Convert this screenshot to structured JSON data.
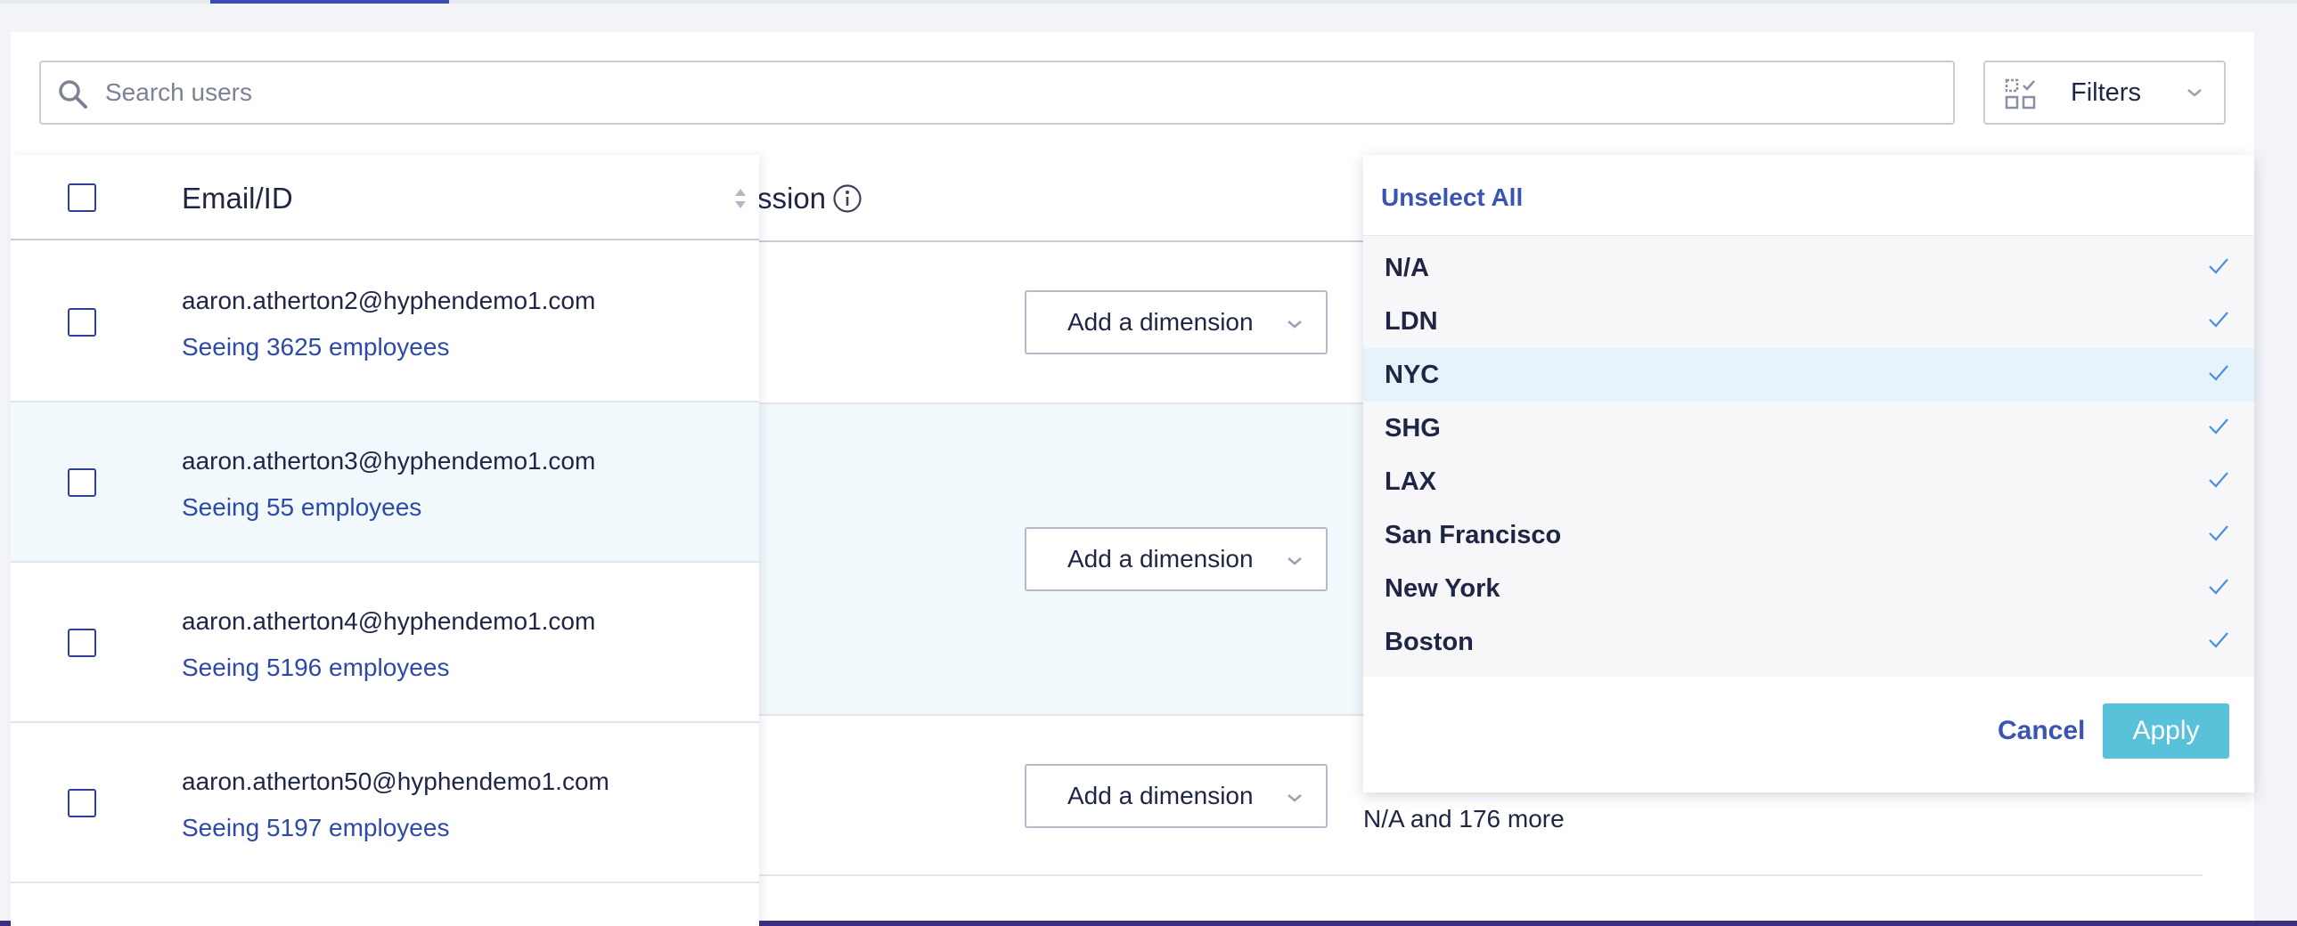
{
  "search": {
    "placeholder": "Search users"
  },
  "filters": {
    "label": "Filters"
  },
  "table": {
    "email_header": "Email/ID",
    "permission_header_partial": "ssion",
    "dimension_button_label": "Add a dimension",
    "more_text": "N/A and 176 more"
  },
  "users": [
    {
      "email": "aaron.atherton2@hyphendemo1.com",
      "seeing": "Seeing 3625 employees"
    },
    {
      "email": "aaron.atherton3@hyphendemo1.com",
      "seeing": "Seeing 55 employees"
    },
    {
      "email": "aaron.atherton4@hyphendemo1.com",
      "seeing": "Seeing 5196 employees"
    },
    {
      "email": "aaron.atherton50@hyphendemo1.com",
      "seeing": "Seeing 5197 employees"
    }
  ],
  "dropdown": {
    "unselect_all": "Unselect All",
    "items": [
      {
        "label": "N/A",
        "checked": true
      },
      {
        "label": "LDN",
        "checked": true
      },
      {
        "label": "NYC",
        "checked": true
      },
      {
        "label": "SHG",
        "checked": true
      },
      {
        "label": "LAX",
        "checked": true
      },
      {
        "label": "San Francisco",
        "checked": true
      },
      {
        "label": "New York",
        "checked": true
      },
      {
        "label": "Boston",
        "checked": true
      }
    ],
    "cancel": "Cancel",
    "apply": "Apply"
  },
  "colors": {
    "accent": "#3a54b4",
    "apply_button": "#59c2da",
    "row_highlight": "#f1f9fd",
    "check": "#4a8fe0"
  }
}
